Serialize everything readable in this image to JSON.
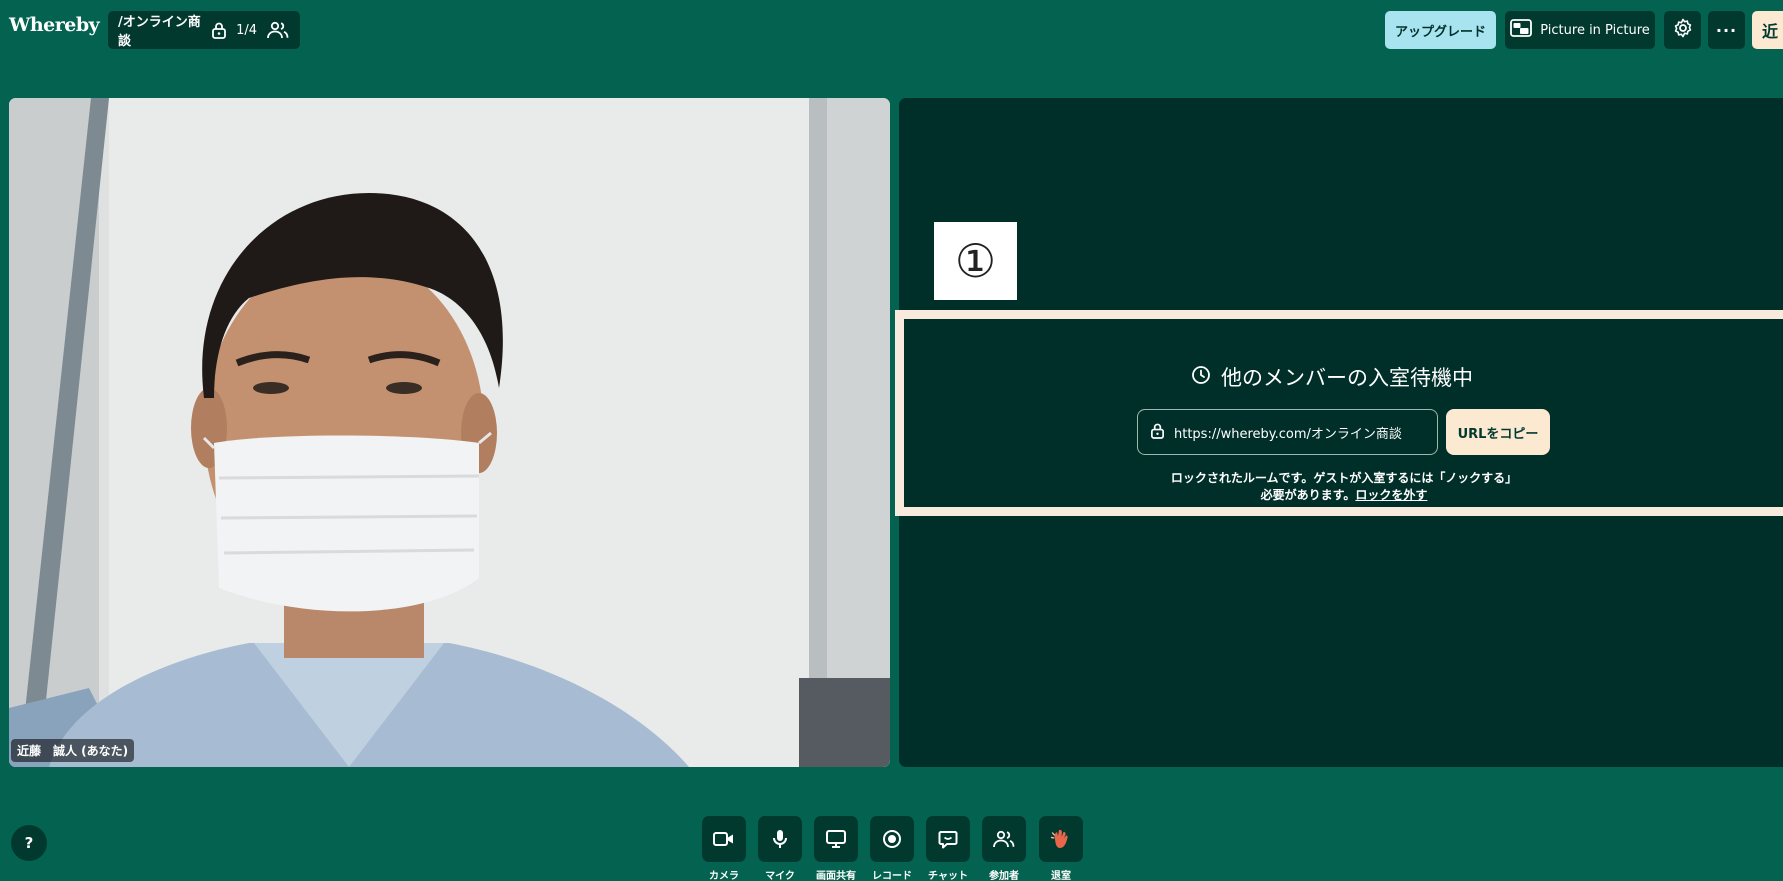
{
  "app": {
    "logo": "Whereby"
  },
  "topbar": {
    "room_name": "/オンライン商談",
    "participant_count": "1/4",
    "upgrade_label": "アップグレード",
    "pip_label": "Picture in Picture",
    "more_label": "···",
    "avatar_initial": "近"
  },
  "video": {
    "self_name": "近藤　誠人 (あなた)"
  },
  "annotation": {
    "marker": "①"
  },
  "waiting": {
    "title": "他のメンバーの入室待機中",
    "room_url": "https://whereby.com/オンライン商談",
    "copy_label": "URLをコピー",
    "lock_note_line1": "ロックされたルームです。ゲストが入室するには「ノックする」",
    "lock_note_line2": "必要があります。",
    "unlock_link": "ロックを外す"
  },
  "help_label": "?",
  "controls": [
    {
      "label": "カメラ",
      "icon": "camera-icon"
    },
    {
      "label": "マイク",
      "icon": "mic-icon"
    },
    {
      "label": "画面共有",
      "icon": "screen-share-icon"
    },
    {
      "label": "レコード",
      "icon": "record-icon"
    },
    {
      "label": "チャット",
      "icon": "chat-icon"
    },
    {
      "label": "参加者",
      "icon": "people-icon"
    },
    {
      "label": "退室",
      "icon": "leave-hand-icon"
    }
  ],
  "colors": {
    "app_bg": "#036350",
    "tile_bg": "#002e28",
    "chip_bg": "#02392f",
    "upgrade_bg": "#a8e3f0",
    "cream": "#fbe9d2",
    "highlight_border": "#f8eadd",
    "leave_hand": "#e8664a"
  }
}
